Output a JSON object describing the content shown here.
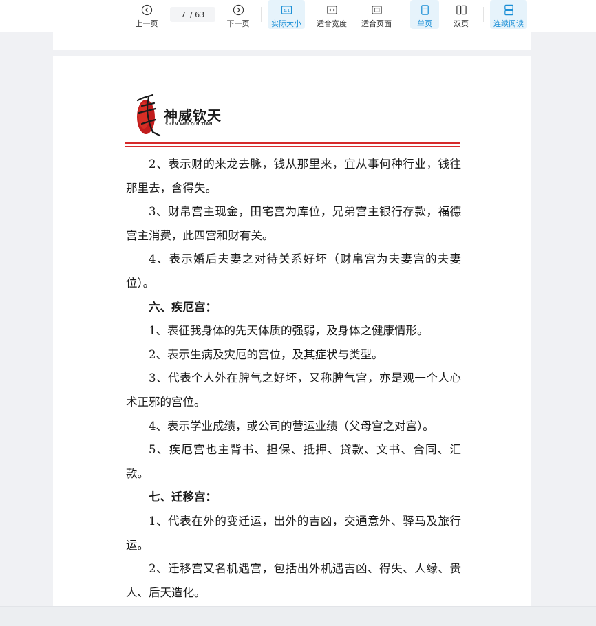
{
  "toolbar": {
    "prev_label": "上一页",
    "page_current": "7",
    "page_total": "/ 63",
    "next_label": "下一页",
    "actual_size_label": "实际大小",
    "fit_width_label": "适合宽度",
    "fit_page_label": "适合页面",
    "single_page_label": "单页",
    "double_page_label": "双页",
    "continuous_label": "连续阅读",
    "accent_color": "#1b8fd6"
  },
  "document": {
    "logo_text": "神威钦天",
    "logo_sub": "SHEN WEI QIN TIAN",
    "paragraphs": [
      {
        "text": "2、表示财的来龙去脉，钱从那里来，宜从事何种行业，钱往那里去，含得失。",
        "heading": false
      },
      {
        "text": "3、财帛宫主现金，田宅宫为库位，兄弟宫主银行存款，福德宫主消费，此四宫和财有关。",
        "heading": false
      },
      {
        "text": "4、表示婚后夫妻之对待关系好坏（财帛宫为夫妻宫的夫妻位）。",
        "heading": false
      },
      {
        "text": "六、疾厄宫：",
        "heading": true
      },
      {
        "text": "1、表征我身体的先天体质的强弱，及身体之健康情形。",
        "heading": false
      },
      {
        "text": "2、表示生病及灾厄的宫位，及其症状与类型。",
        "heading": false
      },
      {
        "text": "3、代表个人外在脾气之好坏，又称脾气宫，亦是观一个人心术正邪的宫位。",
        "heading": false
      },
      {
        "text": "4、表示学业成绩，或公司的营运业绩（父母宫之对宫）。",
        "heading": false
      },
      {
        "text": "5、疾厄宫也主背书、担保、抵押、贷款、文书、合同、汇款。",
        "heading": false
      },
      {
        "text": "七、迁移宫：",
        "heading": true
      },
      {
        "text": "1、代表在外的变迁运，出外的吉凶，交通意外、驿马及旅行运。",
        "heading": false
      },
      {
        "text": "2、迁移宫又名机遇宫，包括出外机遇吉凶、得失、人缘、贵人、后天造化。",
        "heading": false
      }
    ]
  }
}
